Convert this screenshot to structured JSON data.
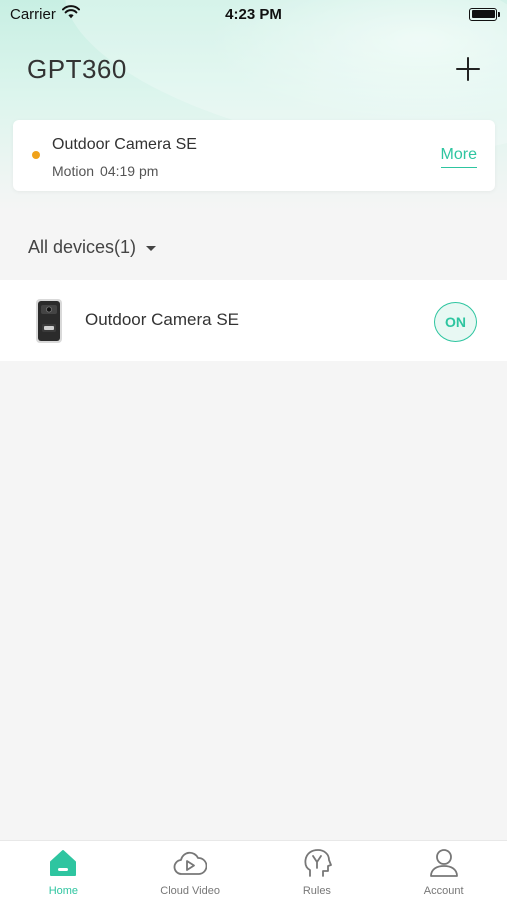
{
  "status_bar": {
    "carrier": "Carrier",
    "time": "4:23 PM"
  },
  "header": {
    "title": "GPT360",
    "add_icon": "plus-icon"
  },
  "alert": {
    "device_name": "Outdoor Camera SE",
    "event": "Motion",
    "time": "04:19 pm",
    "more_label": "More",
    "dot_color": "#f0a21a"
  },
  "devices_section": {
    "filter_label": "All devices(1)"
  },
  "devices": [
    {
      "name": "Outdoor Camera SE",
      "status_label": "ON",
      "icon": "camera-device-icon"
    }
  ],
  "tabbar": {
    "tabs": [
      {
        "label": "Home",
        "icon": "home-icon",
        "active": true
      },
      {
        "label": "Cloud Video",
        "icon": "cloud-video-icon",
        "active": false
      },
      {
        "label": "Rules",
        "icon": "rules-icon",
        "active": false
      },
      {
        "label": "Account",
        "icon": "account-icon",
        "active": false
      }
    ]
  },
  "colors": {
    "accent": "#2ec5a0",
    "alert_dot": "#f0a21a",
    "background": "#f5f5f5"
  }
}
